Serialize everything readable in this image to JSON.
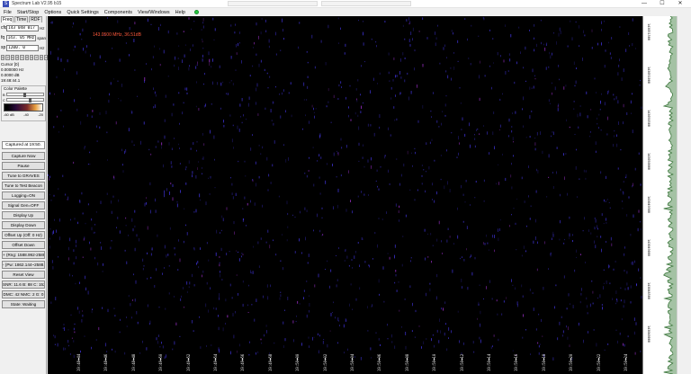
{
  "window": {
    "title": "Spectrum Lab V2.95 b15",
    "minimize": "—",
    "maximize": "☐",
    "close": "✕"
  },
  "menu": [
    "File",
    "Start/Stop",
    "Options",
    "Quick Settings",
    "Components",
    "View/Windows",
    "Help"
  ],
  "left_panel": {
    "tabs": [
      "Freq",
      "Time",
      "RDF"
    ],
    "fields": [
      {
        "label": "cfq",
        "value": "143 048 017",
        "unit": "Hz"
      },
      {
        "label": "fq",
        "value": "143. 05 MHz",
        "unit": "span"
      },
      {
        "label": "sp",
        "value": "1200. 0",
        "unit": "Hz"
      }
    ],
    "nav_buttons": [
      "<",
      ">",
      "<",
      ">",
      "<",
      ">",
      "<",
      ">",
      "<",
      ">"
    ],
    "cursor": {
      "title": "Cursor [0]",
      "freq": "0.000000 Hz",
      "level": "0.0000 dB",
      "time": "19:48:44.1"
    },
    "palette": {
      "title": "Color Palette",
      "sliders": [
        "B",
        "C"
      ],
      "scale": [
        "-60 dB",
        "-40",
        "-20"
      ]
    },
    "captured": "Captured at 19:50.",
    "buttons": [
      "Capture Now",
      "Pause",
      "Tune to GRAVES",
      "Tune to Test Beacon",
      "Logging=ON",
      "Signal Gen=OFF",
      "Display Up",
      "Display Down",
      "Offset Up (Off: 0 Hz)",
      "Offset Down",
      "+ (Rng: 1588.992-2588.5",
      "- (Pw: 1862.144~2588.5",
      "Reset View",
      "SNR: 11.6 B: 88 C: 152",
      "DMC: 42 NMC: 2 G: 0",
      "State: Waiting"
    ]
  },
  "spectrogram": {
    "frequency_label": "143.0500 MHz, 36.51dB",
    "time_ticks": [
      "19:48:44",
      "19:48:46",
      "19:48:48",
      "19:49:50",
      "19:49:52",
      "19:49:54",
      "19:49:56",
      "19:49:58",
      "19:50:00",
      "19:50:02",
      "19:50:04",
      "19:50:06",
      "19:50:08",
      "19:50:10",
      "19:50:12",
      "19:50:14",
      "19:50:16",
      "19:50:18",
      "19:50:20",
      "19:50:22",
      "19:50:24"
    ],
    "colors": {
      "background": "#000000",
      "trace": "#4b3cff",
      "highlight": "#c43cff"
    }
  },
  "right_strip": {
    "labels": [
      "143051500",
      "143051000",
      "143050500",
      "143050000",
      "143049500",
      "143049000",
      "143048500",
      "143048000"
    ],
    "colors": {
      "spectrum": "#2e6b2e",
      "background": "#ffffff"
    }
  }
}
